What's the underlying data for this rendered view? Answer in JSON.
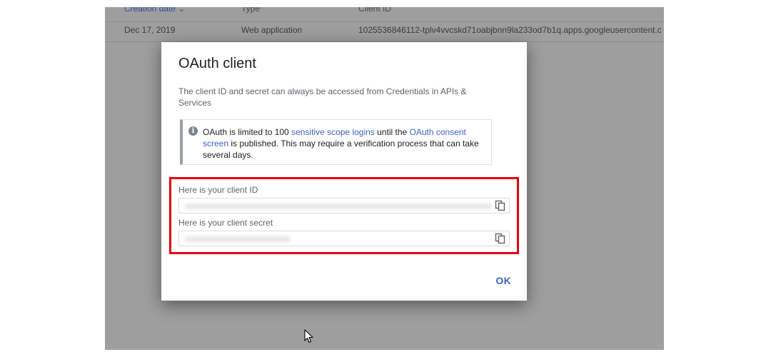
{
  "table": {
    "headers": {
      "creation_date": "Creation date",
      "type": "Type",
      "client_id": "Client ID"
    },
    "rows": [
      {
        "creation_date": "Dec 17, 2019",
        "type": "Web application",
        "client_id": "1025536846112-tplv4vvcskd71oabjbnn9la233od7b1q.apps.googleusercontent.c"
      }
    ]
  },
  "dialog": {
    "title": "OAuth client",
    "description": "The client ID and secret can always be accessed from Credentials in APIs & Services",
    "info": {
      "text_1": "OAuth is limited to 100 ",
      "link_1": "sensitive scope logins",
      "text_2": " until the ",
      "link_2": "OAuth consent screen",
      "text_3": " is published. This may require a verification process that can take several days."
    },
    "client_id_label": "Here is your client ID",
    "client_secret_label": "Here is your client secret",
    "ok_label": "OK"
  },
  "icons": {
    "info": "info-icon",
    "copy": "copy-icon",
    "sort": "chevron-down-icon",
    "cursor": "mouse-cursor"
  },
  "colors": {
    "accent": "#3f63c5",
    "highlight": "#e3000f",
    "backdrop": "#9e9e9e"
  }
}
